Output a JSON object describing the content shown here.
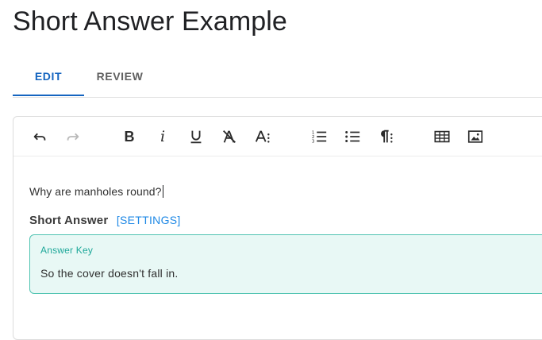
{
  "page": {
    "title": "Short Answer Example"
  },
  "tabs": [
    {
      "label": "EDIT",
      "active": true
    },
    {
      "label": "REVIEW",
      "active": false
    }
  ],
  "toolbar": {
    "buttons": [
      {
        "name": "undo",
        "icon": "undo-icon",
        "disabled": false
      },
      {
        "name": "redo",
        "icon": "redo-icon",
        "disabled": true
      },
      {
        "name": "bold",
        "icon": "bold-icon",
        "disabled": false
      },
      {
        "name": "italic",
        "icon": "italic-icon",
        "disabled": false
      },
      {
        "name": "underline",
        "icon": "underline-icon",
        "disabled": false
      },
      {
        "name": "clear-formatting",
        "icon": "clear-format-icon",
        "disabled": false
      },
      {
        "name": "text-size",
        "icon": "text-size-icon",
        "disabled": false
      },
      {
        "name": "numbered-list",
        "icon": "numbered-list-icon",
        "disabled": false
      },
      {
        "name": "bulleted-list",
        "icon": "bulleted-list-icon",
        "disabled": false
      },
      {
        "name": "paragraph-style",
        "icon": "paragraph-icon",
        "disabled": false
      },
      {
        "name": "insert-table",
        "icon": "table-icon",
        "disabled": false
      },
      {
        "name": "insert-image",
        "icon": "image-icon",
        "disabled": false
      }
    ]
  },
  "content": {
    "question": "Why are manholes round?"
  },
  "short_answer": {
    "title": "Short Answer",
    "settings_label": "[SETTINGS]",
    "answer_key_label": "Answer Key",
    "answer_key_value": "So the cover doesn't fall in."
  },
  "colors": {
    "accent": "#1565c0",
    "link": "#1e88e5",
    "answer_border": "#4fc3b1",
    "answer_background": "#e8f8f5",
    "answer_label": "#1fa89a"
  }
}
